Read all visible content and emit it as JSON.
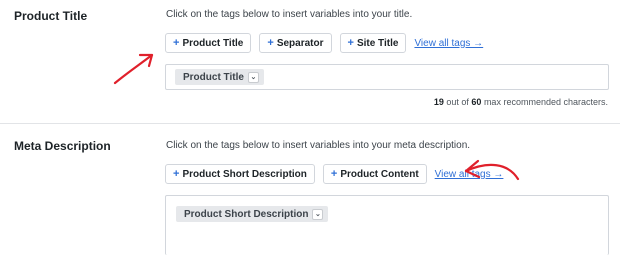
{
  "product_title": {
    "label": "Product Title",
    "help": "Click on the tags below to insert variables into your title.",
    "tags": [
      "Product Title",
      "Separator",
      "Site Title"
    ],
    "view_all": "View all tags →",
    "editor_tag": "Product Title",
    "counter": {
      "count": "19",
      "middle": " out of ",
      "max": "60",
      "suffix": " max recommended characters."
    }
  },
  "meta_description": {
    "label": "Meta Description",
    "help": "Click on the tags below to insert variables into your meta description.",
    "tags": [
      "Product Short Description",
      "Product Content"
    ],
    "view_all": "View all tags →",
    "editor_tag": "Product Short Description"
  },
  "icons": {
    "plus": "+",
    "chevron": "⌄"
  },
  "colors": {
    "accent": "#2f6fd6",
    "annotation": "#e0202b"
  }
}
